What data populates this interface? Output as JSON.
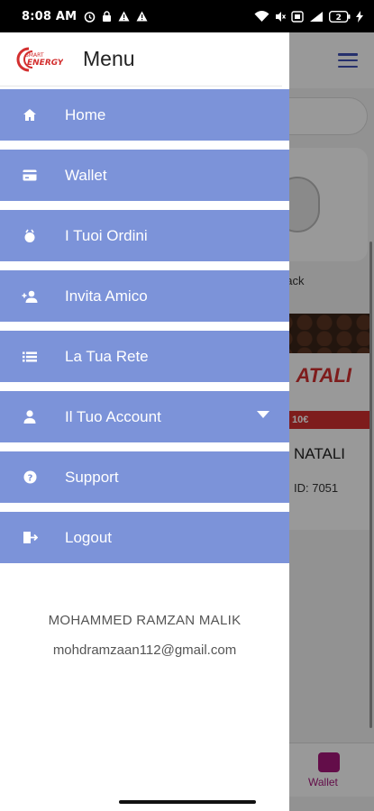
{
  "status_bar": {
    "time": "8:08 AM",
    "left_icons": [
      "alarm-icon",
      "lock-icon",
      "warning-icon",
      "warning-icon"
    ],
    "right_icons": [
      "wifi-icon",
      "mute-icon",
      "sim-icon",
      "signal-icon",
      "battery-icon",
      "charging-icon"
    ],
    "battery_level": "2"
  },
  "drawer": {
    "logo_text": "SMART ENERGY",
    "title": "Menu",
    "items": [
      {
        "label": "Home",
        "icon": "home-icon"
      },
      {
        "label": "Wallet",
        "icon": "card-icon"
      },
      {
        "label": "I Tuoi Ordini",
        "icon": "orders-icon"
      },
      {
        "label": "Invita Amico",
        "icon": "add-person-icon"
      },
      {
        "label": "La Tua Rete",
        "icon": "list-icon"
      },
      {
        "label": "Il Tuo Account",
        "icon": "person-icon",
        "has_dropdown": true
      },
      {
        "label": "Support",
        "icon": "help-icon"
      },
      {
        "label": "Logout",
        "icon": "logout-icon"
      }
    ],
    "user": {
      "name": "MOHAMMED RAMZAN MALIK",
      "email": "mohdramzaan112@gmail.com"
    }
  },
  "background_app": {
    "cashback_label": "back",
    "product_logo": "ATALI",
    "price_tag": "10€",
    "product_name": "NATALI",
    "product_id": "ID: 7051",
    "nav_wallet_label": "Wallet"
  },
  "colors": {
    "menu_item_bg": "#7c93d9",
    "accent_brand": "#d32f2f",
    "hamburger": "#3f51b5",
    "nav_active": "#a5177a"
  }
}
